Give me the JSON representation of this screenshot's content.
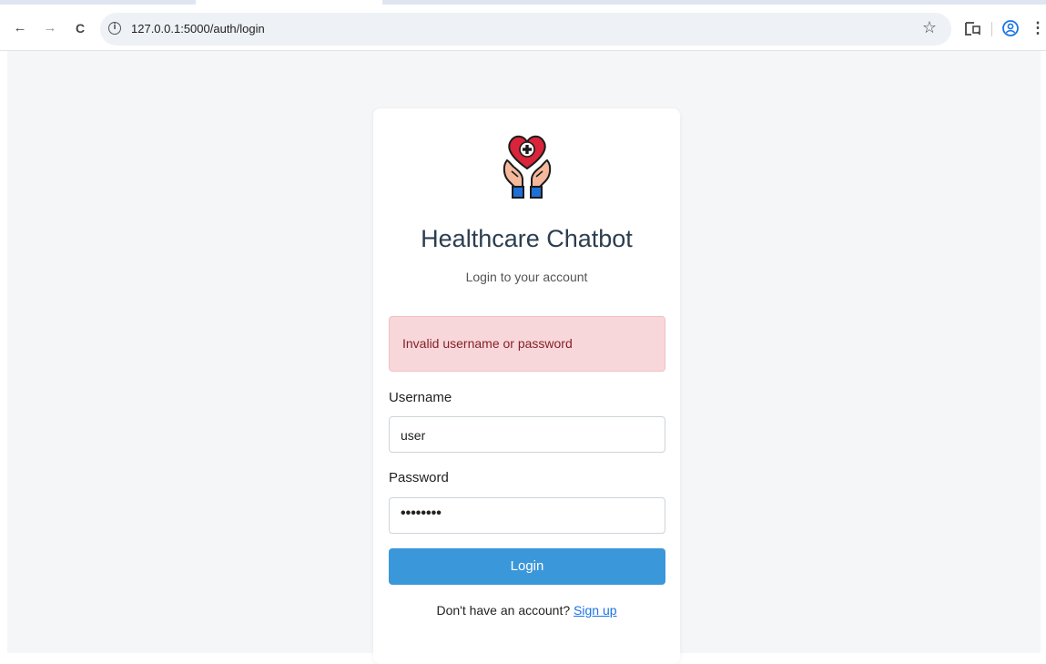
{
  "browser": {
    "url": "127.0.0.1:5000/auth/login",
    "back_icon": "←",
    "forward_icon": "→",
    "reload_icon": "C",
    "info_icon": "i",
    "star_icon": "☆",
    "more_icon": "⋮"
  },
  "app": {
    "title": "Healthcare Chatbot",
    "subtitle": "Login to your account",
    "alert": "Invalid username or password",
    "username_label": "Username",
    "username_value": "user",
    "password_label": "Password",
    "password_value": "••••••••",
    "login_button": "Login",
    "signup_prompt": "Don't have an account?",
    "signup_link": "Sign up"
  },
  "colors": {
    "primary_button": "#3a97da",
    "alert_background": "#f8d7da",
    "alert_text": "#842029",
    "title": "#2c3e50",
    "link": "#1a73e8"
  }
}
